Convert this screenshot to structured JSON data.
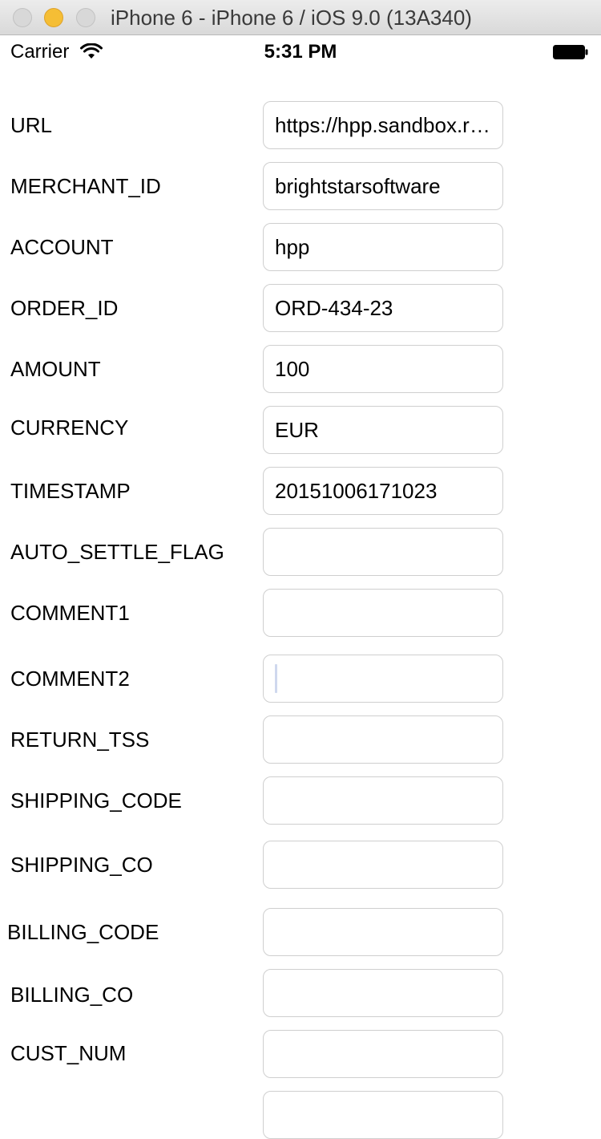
{
  "window": {
    "title": "iPhone 6 - iPhone 6 / iOS 9.0 (13A340)"
  },
  "statusbar": {
    "carrier": "Carrier",
    "time": "5:31 PM",
    "wifi_icon": "wifi-icon",
    "battery_icon": "battery-icon"
  },
  "form": {
    "fields": [
      {
        "label": "URL",
        "value": "https://hpp.sandbox.realexpayments.com/pay"
      },
      {
        "label": "MERCHANT_ID",
        "value": "brightstarsoftware"
      },
      {
        "label": "ACCOUNT",
        "value": "hpp"
      },
      {
        "label": "ORDER_ID",
        "value": "ORD-434-23"
      },
      {
        "label": "AMOUNT",
        "value": "100"
      },
      {
        "label": "CURRENCY",
        "value": "EUR"
      },
      {
        "label": "TIMESTAMP",
        "value": "20151006171023"
      },
      {
        "label": "AUTO_SETTLE_FLAG",
        "value": ""
      },
      {
        "label": "COMMENT1",
        "value": ""
      },
      {
        "label": "COMMENT2",
        "value": "",
        "focused": true
      },
      {
        "label": "RETURN_TSS",
        "value": ""
      },
      {
        "label": "SHIPPING_CODE",
        "value": ""
      },
      {
        "label": "SHIPPING_CO",
        "value": ""
      },
      {
        "label": "BILLING_CODE",
        "value": ""
      },
      {
        "label": "BILLING_CO",
        "value": ""
      },
      {
        "label": "CUST_NUM",
        "value": ""
      },
      {
        "label": "",
        "value": ""
      }
    ]
  },
  "colors": {
    "accent_minimize": "#f5be35",
    "input_border": "#cfcfcf",
    "cursor": "#cfd8ee"
  }
}
